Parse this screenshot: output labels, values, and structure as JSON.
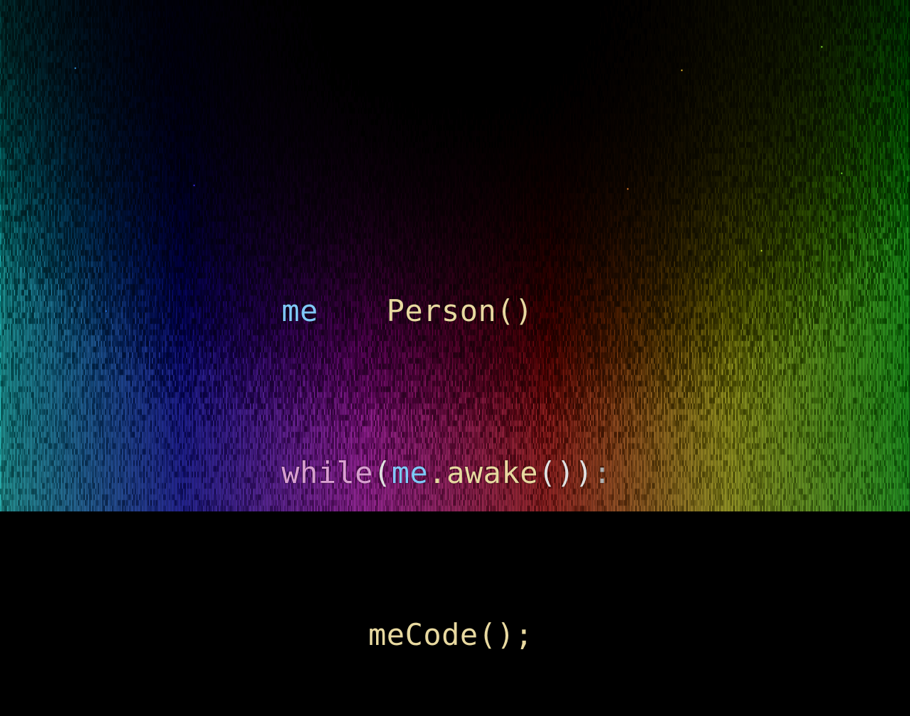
{
  "code": {
    "line1": {
      "var": "me",
      "call": "Person()"
    },
    "line2": {
      "keyword": "while",
      "open": "(",
      "obj": "me",
      "method": ".awake",
      "close": "())",
      "colon": ":"
    },
    "line3": {
      "call": "meCode();"
    }
  },
  "colors": {
    "background": "#000000",
    "variable": "#7fc8f8",
    "keyword": "#d9a0d0",
    "function": "#e8d9a0",
    "punctuation": "#e0e0e0",
    "spectrum": [
      "#00e0e0",
      "#2040ff",
      "#c000ff",
      "#ff20a0",
      "#ff1010",
      "#ff8000",
      "#e0ff00",
      "#20ff20"
    ]
  }
}
